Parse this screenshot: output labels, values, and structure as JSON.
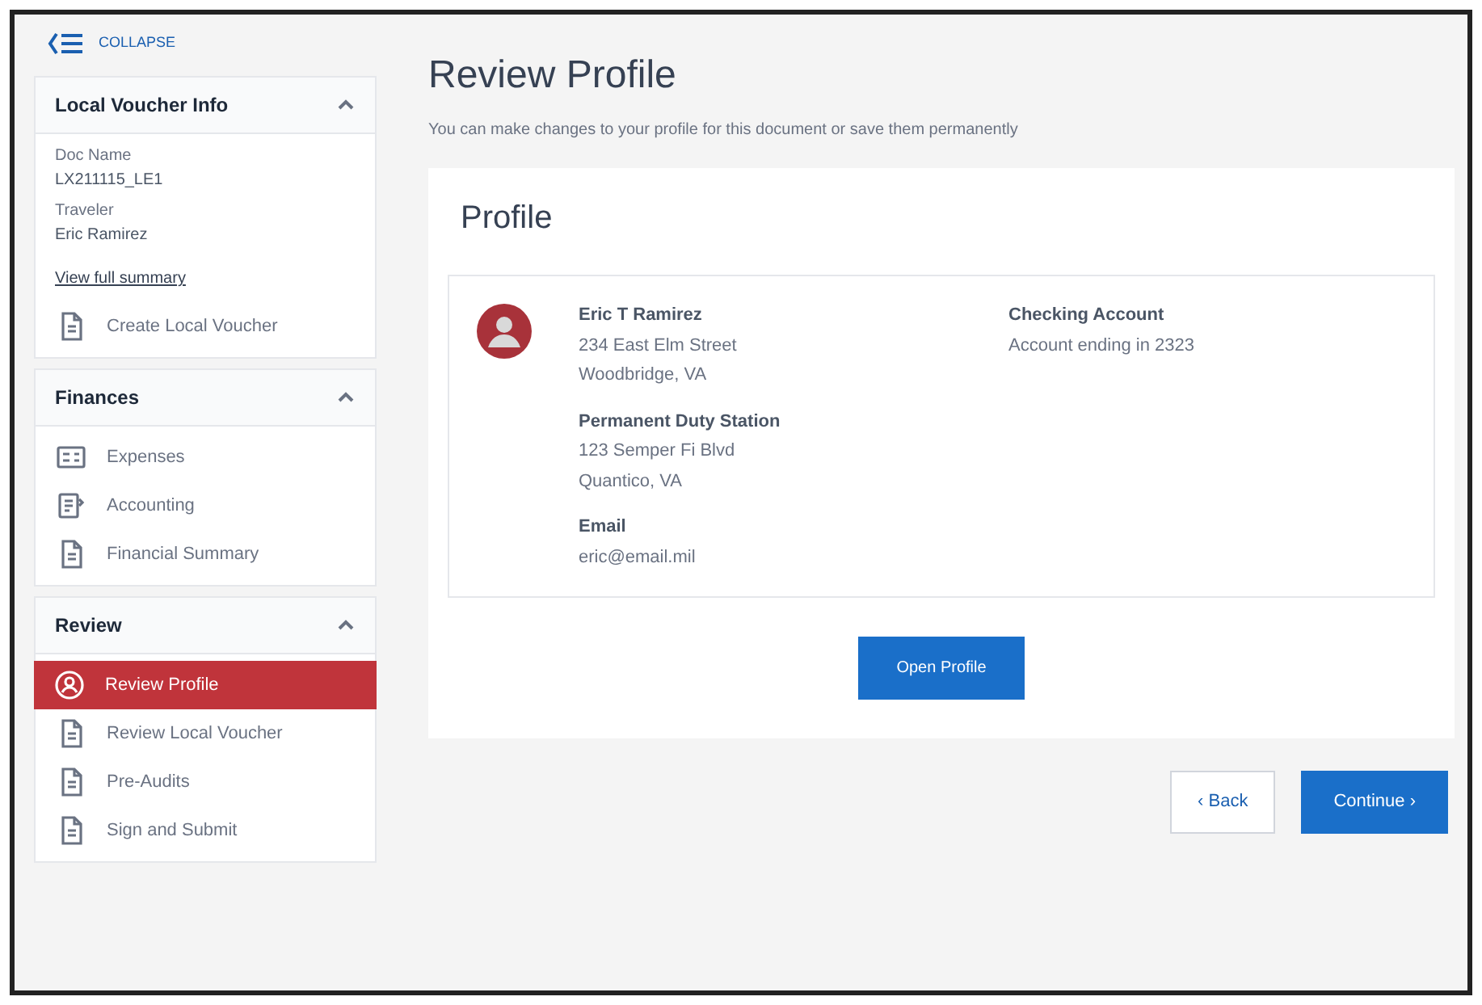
{
  "sidebar": {
    "collapse_label": "COLLAPSE",
    "sections": [
      {
        "title": "Local Voucher Info",
        "expanded": true,
        "fields": [
          {
            "label": "Doc Name",
            "value": "LX211115_LE1"
          },
          {
            "label": "Traveler",
            "value": "Eric Ramirez"
          }
        ],
        "link": "View full summary",
        "items": [
          {
            "label": "Create Local Voucher",
            "kind": "doc",
            "selected": false
          }
        ]
      },
      {
        "title": "Finances",
        "expanded": true,
        "items": [
          {
            "label": "Expenses",
            "kind": "receipt",
            "selected": false
          },
          {
            "label": "Accounting",
            "kind": "ledger",
            "selected": false
          },
          {
            "label": "Financial Summary",
            "kind": "doc",
            "selected": false
          }
        ]
      },
      {
        "title": "Review",
        "expanded": true,
        "items": [
          {
            "label": "Review Profile",
            "kind": "person",
            "selected": true
          },
          {
            "label": "Review Local Voucher",
            "kind": "doc",
            "selected": false
          },
          {
            "label": "Pre-Audits",
            "kind": "doc",
            "selected": false
          },
          {
            "label": "Sign and Submit",
            "kind": "doc",
            "selected": false
          }
        ]
      }
    ]
  },
  "page": {
    "title": "Review Profile",
    "subtitle": "You can make changes to your profile for this document or save them permanently"
  },
  "profile": {
    "title": "Profile",
    "left": [
      {
        "heading": "Eric T Ramirez",
        "lines": [
          "234 East Elm Street",
          "Woodbridge, VA"
        ]
      },
      {
        "heading": "Permanent Duty Station",
        "lines": [
          "123 Semper Fi Blvd",
          "Quantico, VA"
        ]
      },
      {
        "heading": "Email",
        "lines": [
          "eric@email.mil"
        ]
      }
    ],
    "right": [
      {
        "heading": "Checking Account",
        "lines": [
          "Account ending in 2323"
        ]
      }
    ],
    "button": "Open Profile"
  },
  "footer": {
    "back": "‹ Back",
    "continue": "Continue ›"
  }
}
